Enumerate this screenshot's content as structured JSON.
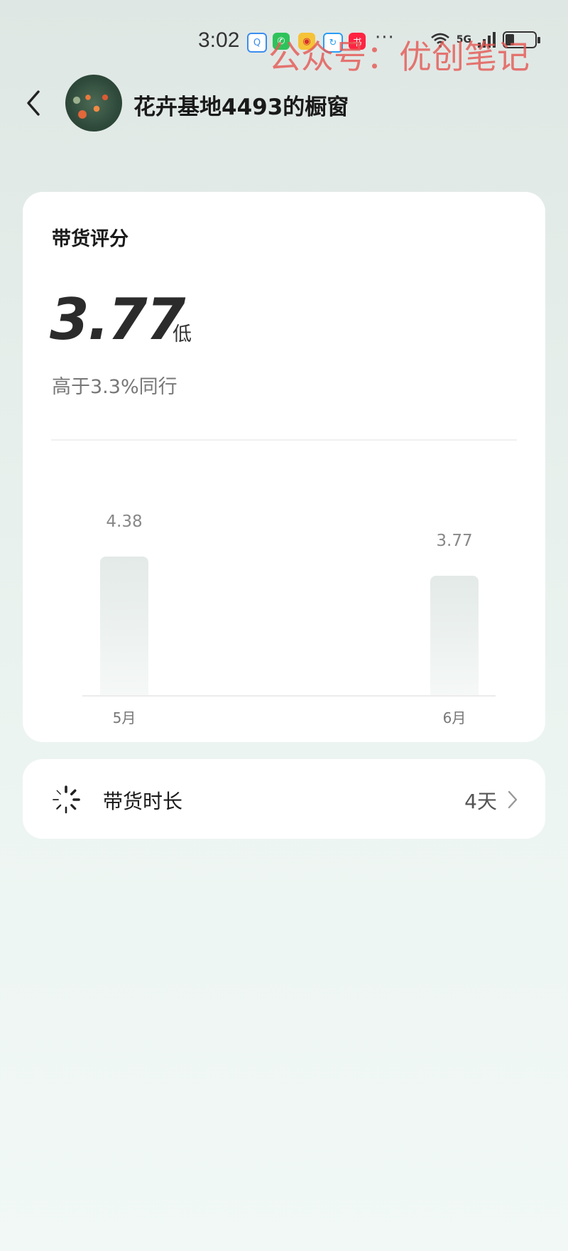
{
  "status_bar": {
    "time": "3:02",
    "more": "···",
    "signal_label": "5G",
    "notification_icons": [
      "qq-icon",
      "wechat-icon",
      "weibo-icon",
      "sync-icon",
      "xiaohongshu-icon"
    ]
  },
  "watermark": "公众号：优创笔记",
  "header": {
    "title": "花卉基地4493的橱窗"
  },
  "score_card": {
    "title": "带货评分",
    "score": "3.77",
    "level": "低",
    "compare": "高于3.3%同行"
  },
  "chart_data": {
    "type": "bar",
    "categories": [
      "5月",
      "6月"
    ],
    "values": [
      4.38,
      3.77
    ],
    "value_labels": [
      "4.38",
      "3.77"
    ],
    "title": "",
    "xlabel": "",
    "ylabel": "",
    "ylim": [
      0,
      5
    ]
  },
  "duration": {
    "label": "带货时长",
    "value": "4天"
  },
  "colors": {
    "watermark": "#e55a56",
    "card_bg": "#ffffff",
    "bar_top": "#e3eae7",
    "bar_bottom": "#f5f8f7"
  }
}
